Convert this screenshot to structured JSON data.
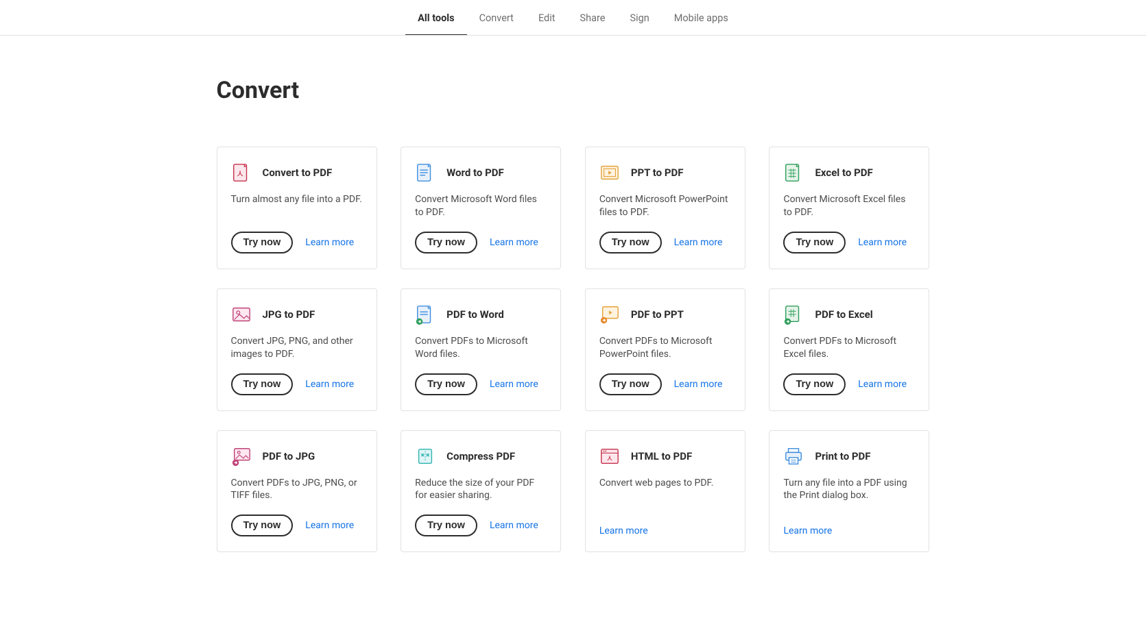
{
  "tabs": [
    {
      "label": "All tools",
      "active": true
    },
    {
      "label": "Convert",
      "active": false
    },
    {
      "label": "Edit",
      "active": false
    },
    {
      "label": "Share",
      "active": false
    },
    {
      "label": "Sign",
      "active": false
    },
    {
      "label": "Mobile apps",
      "active": false
    }
  ],
  "section_title": "Convert",
  "try_now_label": "Try now",
  "learn_more_label": "Learn more",
  "cards": [
    {
      "icon": "convert-to-pdf-icon",
      "title": "Convert to PDF",
      "desc": "Turn almost any file into a PDF.",
      "try": true
    },
    {
      "icon": "word-to-pdf-icon",
      "title": "Word to PDF",
      "desc": "Convert Microsoft Word files to PDF.",
      "try": true
    },
    {
      "icon": "ppt-to-pdf-icon",
      "title": "PPT to PDF",
      "desc": "Convert Microsoft PowerPoint files to PDF.",
      "try": true
    },
    {
      "icon": "excel-to-pdf-icon",
      "title": "Excel to PDF",
      "desc": "Convert Microsoft Excel files to PDF.",
      "try": true
    },
    {
      "icon": "jpg-to-pdf-icon",
      "title": "JPG to PDF",
      "desc": "Convert JPG, PNG, and other images to PDF.",
      "try": true
    },
    {
      "icon": "pdf-to-word-icon",
      "title": "PDF to Word",
      "desc": "Convert PDFs to Microsoft Word files.",
      "try": true
    },
    {
      "icon": "pdf-to-ppt-icon",
      "title": "PDF to PPT",
      "desc": "Convert PDFs to Microsoft PowerPoint files.",
      "try": true
    },
    {
      "icon": "pdf-to-excel-icon",
      "title": "PDF to Excel",
      "desc": "Convert PDFs to Microsoft Excel files.",
      "try": true
    },
    {
      "icon": "pdf-to-jpg-icon",
      "title": "PDF to JPG",
      "desc": "Convert PDFs to JPG, PNG, or TIFF files.",
      "try": true
    },
    {
      "icon": "compress-pdf-icon",
      "title": "Compress PDF",
      "desc": "Reduce the size of your PDF for easier sharing.",
      "try": true
    },
    {
      "icon": "html-to-pdf-icon",
      "title": "HTML to PDF",
      "desc": "Convert web pages to PDF.",
      "try": false
    },
    {
      "icon": "print-to-pdf-icon",
      "title": "Print to PDF",
      "desc": "Turn any file into a PDF using the Print dialog box.",
      "try": false
    }
  ]
}
